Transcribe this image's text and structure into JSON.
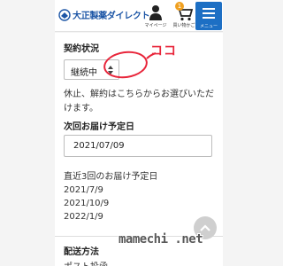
{
  "header": {
    "logo_text": "大正製薬ダイレクト",
    "mypage_label": "マイページ",
    "cart_label": "買い物かご",
    "cart_count": "1",
    "menu_label": "メニュー"
  },
  "contract": {
    "title": "契約状況",
    "status_value": "継続中",
    "note": "休止、解約はこちらからお選びいただけます。"
  },
  "next_delivery": {
    "title": "次回お届け予定日",
    "date_value": "2021/07/09",
    "recent_title": "直近3回のお届け予定日",
    "recent_dates": [
      "2021/7/9",
      "2021/10/9",
      "2022/1/9"
    ]
  },
  "shipping": {
    "title": "配送方法",
    "value": "ポスト投函"
  },
  "annotation": {
    "text": "ココ",
    "color": "#e8253a"
  },
  "watermark": "mamechi .net",
  "colors": {
    "brand": "#1d56a6",
    "menu_button": "#1d6fc4",
    "badge": "#f0a020"
  }
}
